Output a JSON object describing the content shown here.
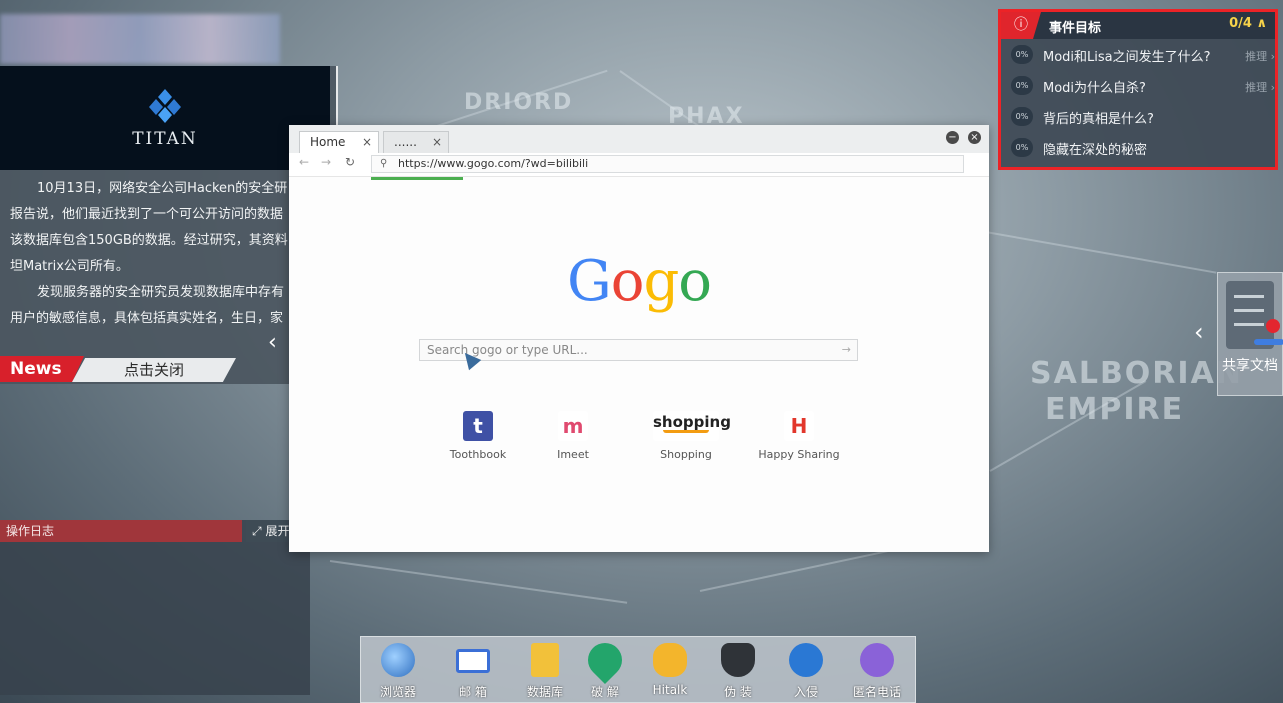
{
  "map": {
    "labels": [
      "DRIORD",
      "PHAX",
      "SALBORIAN",
      "EMPIRE"
    ]
  },
  "news": {
    "brand": "TITAN",
    "paragraphs": [
      "10月13日，网络安全公司Hacken的安全研",
      "报告说，他们最近找到了一个可公开访问的数据",
      "该数据库包含150GB的数据。经过研究，其资料",
      "坦Matrix公司所有。",
      "发现服务器的安全研究员发现数据库中存有",
      "用户的敏感信息，具体包括真实姓名，生日，家"
    ],
    "tag": "News",
    "close_label": "点击关闭"
  },
  "log": {
    "title": "操作日志",
    "expand_label": "展开"
  },
  "objectives": {
    "title": "事件目标",
    "count": "0/4",
    "items": [
      {
        "pct": "0%",
        "text": "Modi和Lisa之间发生了什么?",
        "hint": "推理"
      },
      {
        "pct": "0%",
        "text": "Modi为什么自杀?",
        "hint": "推理"
      },
      {
        "pct": "0%",
        "text": "背后的真相是什么?",
        "hint": ""
      },
      {
        "pct": "0%",
        "text": "隐藏在深处的秘密",
        "hint": ""
      }
    ]
  },
  "shared_docs": {
    "label": "共享文档"
  },
  "browser": {
    "tabs": [
      {
        "label": "Home"
      },
      {
        "label": "......"
      }
    ],
    "url": "https://www.gogo.com/?wd=bilibili",
    "logo": [
      "G",
      "o",
      "g",
      "o"
    ],
    "logo_colors": [
      "#4285f4",
      "#ea4335",
      "#fbbc05",
      "#34a853"
    ],
    "search_placeholder": "Search gogo or type URL...",
    "shortcuts": [
      {
        "label": "Toothbook",
        "icon": "toothbook-icon",
        "glyph": "t",
        "color": "#3f51a5"
      },
      {
        "label": "Imeet",
        "icon": "imeet-icon",
        "glyph": "m",
        "color": "#e04a6f"
      },
      {
        "label": "Shopping",
        "icon": "shopping-icon",
        "glyph": "shopping",
        "color": "#222222"
      },
      {
        "label": "Happy Sharing",
        "icon": "happy-sharing-icon",
        "glyph": "H",
        "color": "#e2372c"
      }
    ]
  },
  "dock": {
    "items": [
      {
        "label": "浏览器",
        "icon": "browser-globe-icon",
        "color": "#3d7fd0"
      },
      {
        "label": "邮 箱",
        "icon": "mail-icon",
        "color": "#3b6fd6"
      },
      {
        "label": "数据库",
        "icon": "database-sql-icon",
        "color": "#f2c13a"
      },
      {
        "label": "破 解",
        "icon": "crack-key-icon",
        "color": "#23a56b"
      },
      {
        "label": "Hitalk",
        "icon": "hitalk-icon",
        "color": "#f3b52c"
      },
      {
        "label": "伪 装",
        "icon": "disguise-icon",
        "color": "#2f3338"
      },
      {
        "label": "入侵",
        "icon": "intrude-hook-icon",
        "color": "#2a78d4"
      },
      {
        "label": "匿名电话",
        "icon": "phone-icon",
        "color": "#8a62d8"
      }
    ]
  }
}
